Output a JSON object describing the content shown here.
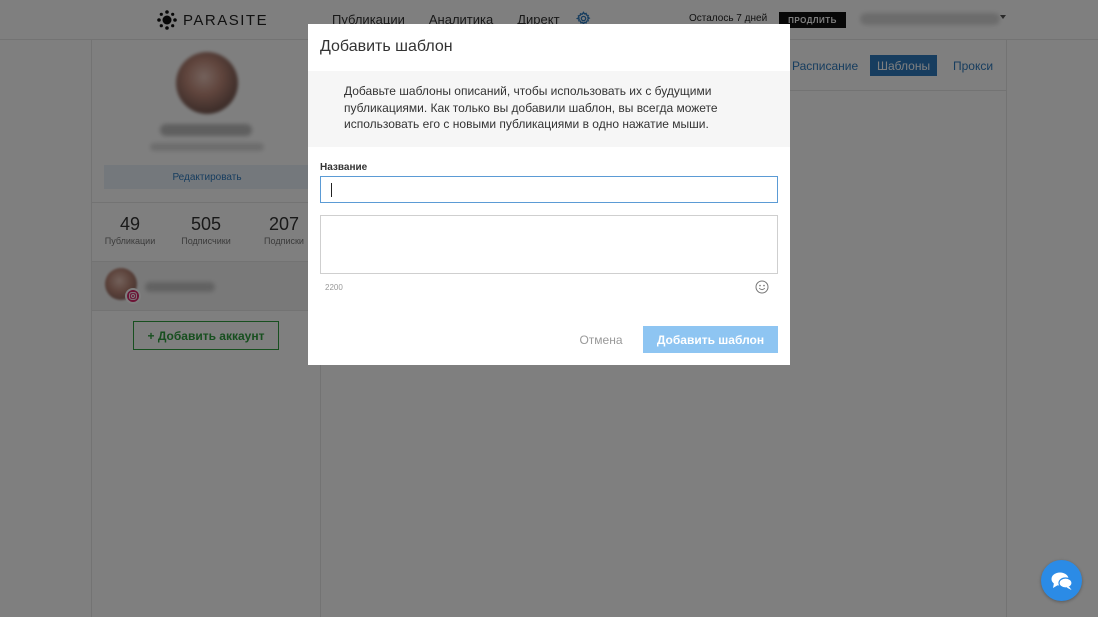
{
  "header": {
    "logo_text": "PARASITE",
    "nav": [
      "Публикации",
      "Аналитика",
      "Директ"
    ],
    "trial_text": "Осталось 7 дней",
    "extend_label": "ПРОДЛИТЬ"
  },
  "sidebar": {
    "edit_label": "Редактировать",
    "stats": [
      {
        "value": "49",
        "label": "Публикации"
      },
      {
        "value": "505",
        "label": "Подписчики"
      },
      {
        "value": "207",
        "label": "Подписки"
      }
    ],
    "add_account_label": "+ Добавить аккаунт"
  },
  "main": {
    "tabs": [
      {
        "label": "Расписание",
        "active": false
      },
      {
        "label": "Шаблоны",
        "active": true
      },
      {
        "label": "Прокси",
        "active": false
      }
    ]
  },
  "modal": {
    "title": "Добавить шаблон",
    "description": "Добавьте шаблоны описаний, чтобы использовать их с будущими публикациями. Как только вы добавили шаблон, вы всегда можете использовать его с новыми публикациями в одно нажатие мыши.",
    "name_label": "Название",
    "name_value": "",
    "description_value": "",
    "char_counter": "2200",
    "cancel_label": "Отмена",
    "submit_label": "Добавить шаблон"
  },
  "colors": {
    "accent": "#2f7bbf",
    "submit_disabled": "#8ec5f2",
    "add_account": "#2e9e3e",
    "chat": "#2b8be6"
  },
  "icons": [
    "logo-icon",
    "gear-icon",
    "chevron-down-icon",
    "instagram-icon",
    "emoji-icon",
    "chat-icon"
  ]
}
